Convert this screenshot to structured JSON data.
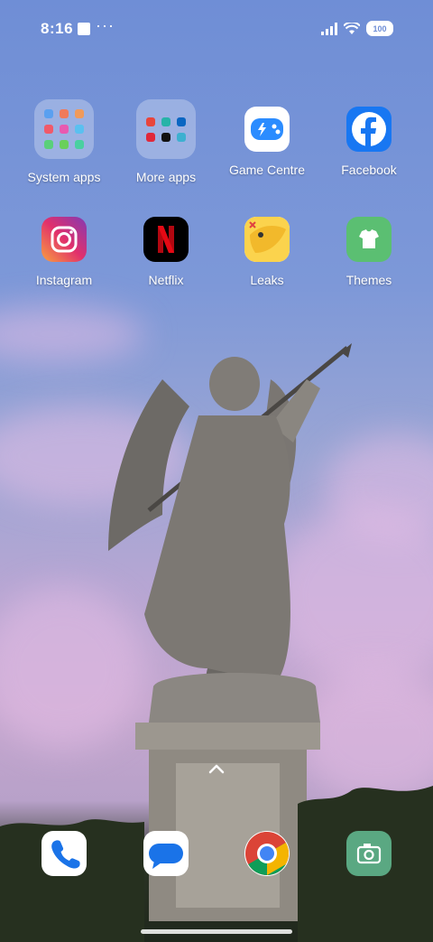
{
  "status_bar": {
    "time": "8:16",
    "overflow": "···",
    "battery": "100"
  },
  "apps": [
    {
      "id": "system-apps",
      "label": "System apps"
    },
    {
      "id": "more-apps",
      "label": "More apps"
    },
    {
      "id": "game-centre",
      "label": "Game Centre"
    },
    {
      "id": "facebook",
      "label": "Facebook"
    },
    {
      "id": "instagram",
      "label": "Instagram"
    },
    {
      "id": "netflix",
      "label": "Netflix"
    },
    {
      "id": "leaks",
      "label": "Leaks"
    },
    {
      "id": "themes",
      "label": "Themes"
    }
  ],
  "dock": [
    {
      "id": "phone",
      "icon": "phone-icon"
    },
    {
      "id": "messages",
      "icon": "messages-icon"
    },
    {
      "id": "chrome",
      "icon": "chrome-icon"
    },
    {
      "id": "camera",
      "icon": "camera-icon"
    }
  ],
  "colors": {
    "facebook": "#1877f2",
    "netflix_bg": "#000000",
    "netflix_red": "#e50914",
    "themes": "#5bbf72",
    "camera": "#5aa882",
    "game_centre": "#2b8cff"
  }
}
